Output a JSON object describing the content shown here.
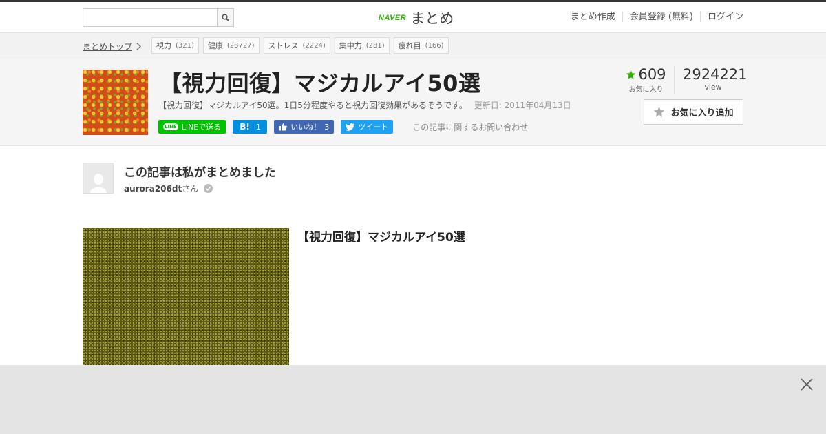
{
  "header": {
    "search_placeholder": "",
    "logo_naver": "NAVER",
    "logo_matome": "まとめ",
    "links": [
      "まとめ作成",
      "会員登録 (無料)",
      "ログイン"
    ]
  },
  "breadcrumb": {
    "top": "まとめトップ",
    "tags": [
      {
        "label": "視力",
        "count": "(321)"
      },
      {
        "label": "健康",
        "count": "(23727)"
      },
      {
        "label": "ストレス",
        "count": "(2224)"
      },
      {
        "label": "集中力",
        "count": "(281)"
      },
      {
        "label": "疲れ目",
        "count": "(166)"
      }
    ]
  },
  "article": {
    "title": "【視力回復】マジカルアイ50選",
    "description": "【視力回復】マジカルアイ50選。1日5分程度やると視力回復効果があるそうです。",
    "updated": "更新日: 2011年04月13日",
    "social": {
      "line": "LINEで送る",
      "line_badge": "LINE",
      "hatena_icon": "B!",
      "hatena_count": "1",
      "fb_label": "いいね！",
      "fb_count": "3",
      "tweet": "ツイート"
    },
    "contact": "この記事に関するお問い合わせ",
    "favorites_count": "609",
    "favorites_label": "お気に入り",
    "views_count": "2924221",
    "views_label": "view",
    "fav_button": "お気に入り追加"
  },
  "author": {
    "heading": "この記事は私がまとめました",
    "name": "aurora206dt",
    "suffix": "さん"
  },
  "content": {
    "item_title": "【視力回復】マジカルアイ50選"
  },
  "colors": {
    "brand_green": "#2db400",
    "line": "#00c300",
    "hatena": "#008fde",
    "facebook": "#4267b2",
    "twitter": "#1da1f2"
  }
}
